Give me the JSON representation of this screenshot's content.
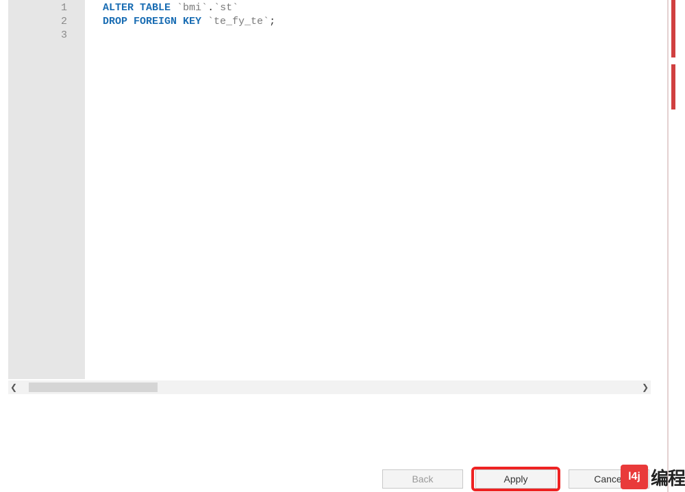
{
  "editor": {
    "lines": [
      {
        "n": "1",
        "segments": [
          {
            "cls": "kw",
            "t": "ALTER TABLE"
          },
          {
            "cls": "pn",
            "t": " "
          },
          {
            "cls": "bt",
            "t": "`bmi`"
          },
          {
            "cls": "pn",
            "t": "."
          },
          {
            "cls": "bt",
            "t": "`st`"
          }
        ]
      },
      {
        "n": "2",
        "segments": [
          {
            "cls": "kw",
            "t": "DROP FOREIGN KEY"
          },
          {
            "cls": "pn",
            "t": " "
          },
          {
            "cls": "bt",
            "t": "`te_fy_te`"
          },
          {
            "cls": "pn",
            "t": ";"
          }
        ]
      },
      {
        "n": "3",
        "segments": []
      }
    ]
  },
  "scroll": {
    "left_arrow": "❮",
    "right_arrow": "❯"
  },
  "buttons": {
    "back": "Back",
    "apply": "Apply",
    "cancel": "Cancel"
  },
  "watermark": {
    "badge": "l4j",
    "text": "编程"
  }
}
